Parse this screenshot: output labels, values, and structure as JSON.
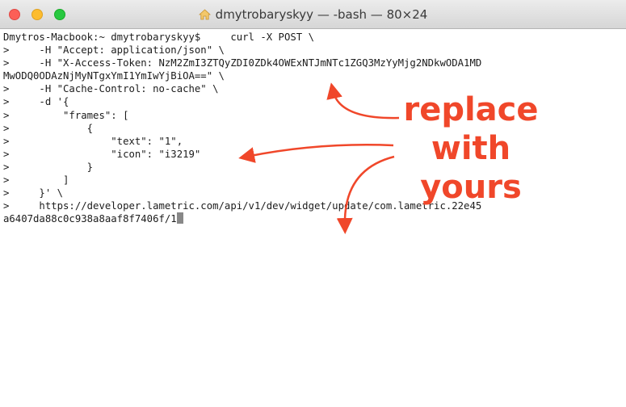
{
  "window": {
    "title": "dmytrobaryskyy — -bash — 80×24",
    "title_icon": "home-icon",
    "traffic_lights": [
      "close",
      "minimize",
      "maximize"
    ]
  },
  "terminal": {
    "lines": [
      "Dmytros-Macbook:~ dmytrobaryskyy$     curl -X POST \\",
      ">     -H \"Accept: application/json\" \\",
      ">     -H \"X-Access-Token: NzM2ZmI3ZTQyZDI0ZDk4OWExNTJmNTc1ZGQ3MzYyMjg2NDkwODA1MD",
      "MwODQ0ODAzNjMyNTgxYmI1YmIwYjBiOA==\" \\",
      ">     -H \"Cache-Control: no-cache\" \\",
      ">     -d '{",
      ">         \"frames\": [",
      ">             {",
      ">                 \"text\": \"1\",",
      ">                 \"icon\": \"i3219\"",
      ">             }",
      ">         ]",
      ">     }' \\",
      ">     https://developer.lametric.com/api/v1/dev/widget/update/com.lametric.22e45",
      "a6407da88c0c938a8aaf8f7406f/1"
    ]
  },
  "annotation": {
    "lines": [
      "replace",
      "with",
      "yours"
    ],
    "color": "#f0472a"
  }
}
